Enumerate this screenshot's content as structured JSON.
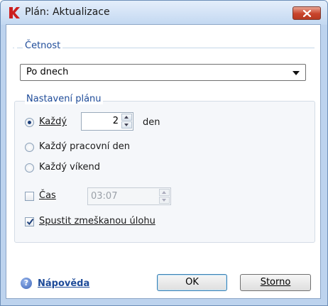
{
  "window": {
    "title": "Plán: Aktualizace",
    "icon": "kaspersky-k-icon",
    "accent_red": "#cc1f1f"
  },
  "frequency": {
    "section_label": "Četnost",
    "selected": "Po dnech"
  },
  "schedule": {
    "section_label": "Nastavení plánu",
    "every_label": "Každý",
    "every_value": "2",
    "every_unit": "den",
    "workday_label": "Každý pracovní den",
    "weekend_label": "Každý víkend",
    "selected_option": "every",
    "time_label": "Čas",
    "time_value": "03:07",
    "time_checked": false,
    "run_missed_label": "Spustit zmeškanou úlohu",
    "run_missed_checked": true
  },
  "footer": {
    "help_label": "Nápověda",
    "ok_label": "OK",
    "cancel_label": "Storno"
  }
}
